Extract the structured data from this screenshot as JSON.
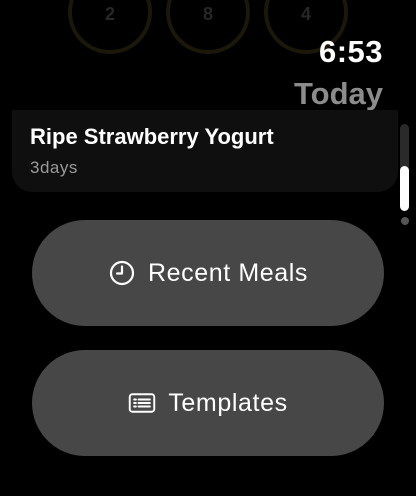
{
  "status": {
    "time": "6:53",
    "day": "Today"
  },
  "food_item": {
    "title": "Ripe Strawberry Yogurt",
    "subtitle": "3days"
  },
  "actions": [
    {
      "label": "Recent Meals",
      "icon": "clock-icon"
    },
    {
      "label": "Templates",
      "icon": "list-icon"
    }
  ],
  "background_rings": {
    "labels": [
      "2",
      "8",
      "4"
    ]
  },
  "colors": {
    "background": "#000000",
    "button": "#474747",
    "secondary_text": "#8c8c8c"
  }
}
